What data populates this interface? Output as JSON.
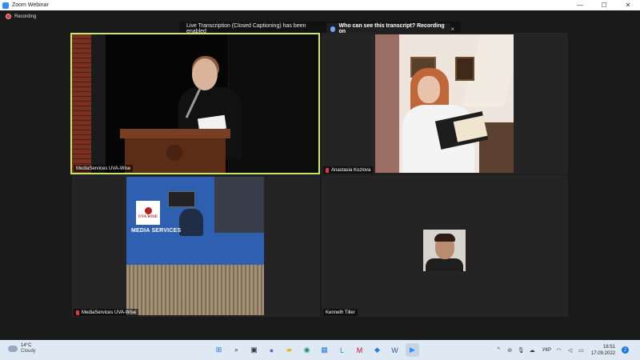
{
  "window": {
    "title": "Zoom Webinar",
    "controls": {
      "minimize": "—",
      "maximize": "☐",
      "close": "✕"
    }
  },
  "recording": {
    "label": "Recording"
  },
  "transcript_banner": {
    "message": "Live Transcription (Closed Captioning) has been enabled",
    "who_label": "Who can see this transcript? Recording on",
    "close_label": "×"
  },
  "participants": [
    {
      "name": "MediaServices UVA-Wise",
      "muted": false,
      "active_speaker": true
    },
    {
      "name": "Anastasia Kozlova",
      "muted": true,
      "active_speaker": false
    },
    {
      "name": "MediaServices UVA-Wise",
      "muted": true,
      "active_speaker": false
    },
    {
      "name": "Kenneth Tiller",
      "muted": false,
      "active_speaker": false
    }
  ],
  "media_services_video": {
    "logo_text": "UVA WISE",
    "caption": "MEDIA SERVICES"
  },
  "taskbar": {
    "weather": {
      "temp": "14°C",
      "condition": "Cloudy"
    },
    "apps": [
      {
        "name": "start",
        "glyph": "⊞",
        "color": "#1a73e8"
      },
      {
        "name": "search",
        "glyph": "⌕",
        "color": "#222222"
      },
      {
        "name": "task-view",
        "glyph": "▣",
        "color": "#333333"
      },
      {
        "name": "chat",
        "glyph": "●",
        "color": "#6a5acd"
      },
      {
        "name": "file-explorer",
        "glyph": "▰",
        "color": "#e6b422"
      },
      {
        "name": "edge",
        "glyph": "◉",
        "color": "#1c8c7a"
      },
      {
        "name": "store",
        "glyph": "▦",
        "color": "#2a7ae2"
      },
      {
        "name": "l-app",
        "glyph": "L",
        "color": "#1a8fd6"
      },
      {
        "name": "mcafee",
        "glyph": "M",
        "color": "#c8102e"
      },
      {
        "name": "app-blue",
        "glyph": "◆",
        "color": "#2a7ae2"
      },
      {
        "name": "app-word",
        "glyph": "W",
        "color": "#2b579a"
      },
      {
        "name": "zoom",
        "glyph": "▶",
        "color": "#2d8cff"
      }
    ],
    "tray": {
      "chevron": "^",
      "icons": [
        "⊘",
        "🎙",
        "☁"
      ],
      "language": "УКР",
      "wifi": "◠",
      "volume": "◁",
      "battery": "▭",
      "time": "16:51",
      "date": "17.09.2022",
      "notifications": "2"
    }
  }
}
